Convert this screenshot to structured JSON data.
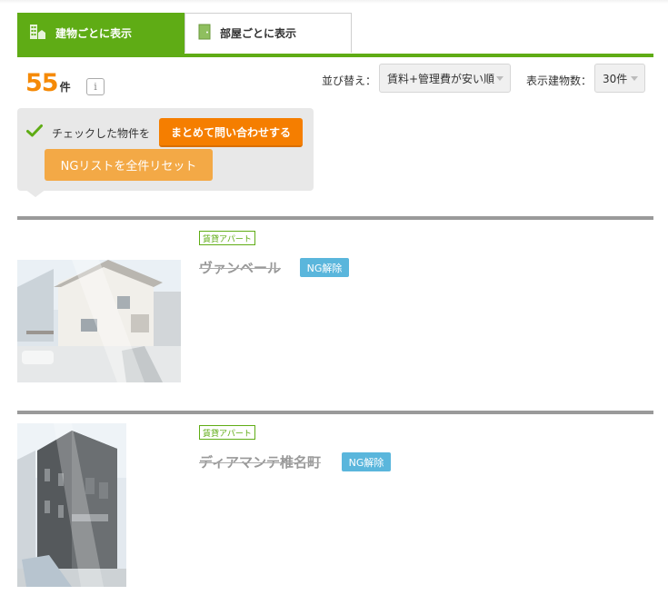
{
  "tabs": {
    "building": "建物ごとに表示",
    "room": "部屋ごとに表示"
  },
  "result": {
    "count": "55",
    "unit": "件",
    "info_icon": "i"
  },
  "sort": {
    "label": "並び替え：",
    "value": "賃料+管理費が安い順"
  },
  "per_page": {
    "label": "表示建物数：",
    "value": "30件"
  },
  "actions": {
    "checked_label": "チェックした物件を",
    "inquire_button": "まとめて問い合わせする",
    "reset_button": "NGリストを全件リセット"
  },
  "listings": [
    {
      "type": "賃貸アパート",
      "name": "ヴァンベール",
      "ng_button": "NG解除"
    },
    {
      "type": "賃貸アパート",
      "name": "ディアマンテ椎名町",
      "ng_button": "NG解除"
    }
  ],
  "colors": {
    "brand_green": "#5fac15",
    "accent_orange": "#f57e00",
    "reset_orange": "#f3a946",
    "ng_blue": "#5ab6dc"
  }
}
